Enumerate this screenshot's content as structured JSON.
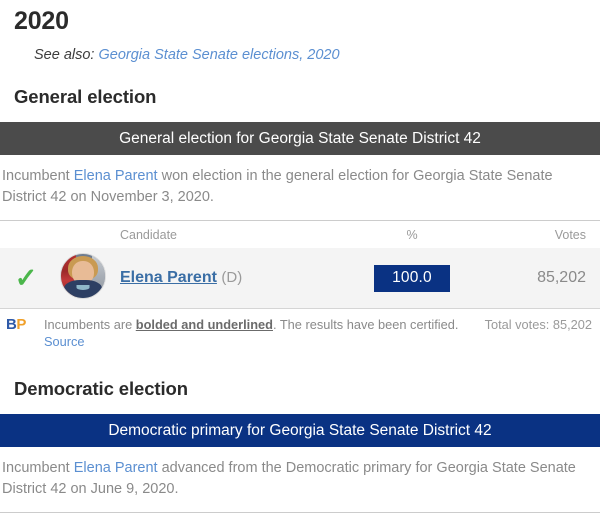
{
  "page": {
    "year_heading": "2020",
    "see_also_prefix": "See also:",
    "see_also_link": "Georgia State Senate elections, 2020"
  },
  "colors": {
    "general_bar": "#4b4b4b",
    "primary_bar": "#0a3283",
    "percent_badge": "#0a3283",
    "link": "#5b8fd1",
    "candidate_link": "#3a6ea5",
    "check_green": "#4bb64b",
    "bp_blue": "#2f5aa8",
    "bp_orange": "#f0a02a",
    "row_background": "#f4f4f4"
  },
  "general_election": {
    "section_heading": "General election",
    "bar_title": "General election for Georgia State Senate District 42",
    "description_before_link": "Incumbent ",
    "description_link": "Elena Parent",
    "description_after_link": " won election in the general election for Georgia State Senate District 42 on November 3, 2020.",
    "columns": {
      "candidate": "Candidate",
      "percent": "%",
      "votes": "Votes"
    },
    "candidates": [
      {
        "winner_mark": "✓",
        "name": "Elena Parent",
        "party": "(D)",
        "percent": "100.0",
        "votes": "85,202"
      }
    ],
    "footnote": {
      "logo_b": "B",
      "logo_p": "P",
      "text_before_bold": "Incumbents are ",
      "bold_underlined": "bolded and underlined",
      "text_after_bold": ". The results have been certified. ",
      "source_link": "Source",
      "total_votes": "Total votes: 85,202"
    }
  },
  "democratic_election": {
    "section_heading": "Democratic election",
    "bar_title": "Democratic primary for Georgia State Senate District 42",
    "description_before_link": "Incumbent ",
    "description_link": "Elena Parent",
    "description_after_link": " advanced from the Democratic primary for Georgia State Senate District 42 on June 9, 2020."
  }
}
